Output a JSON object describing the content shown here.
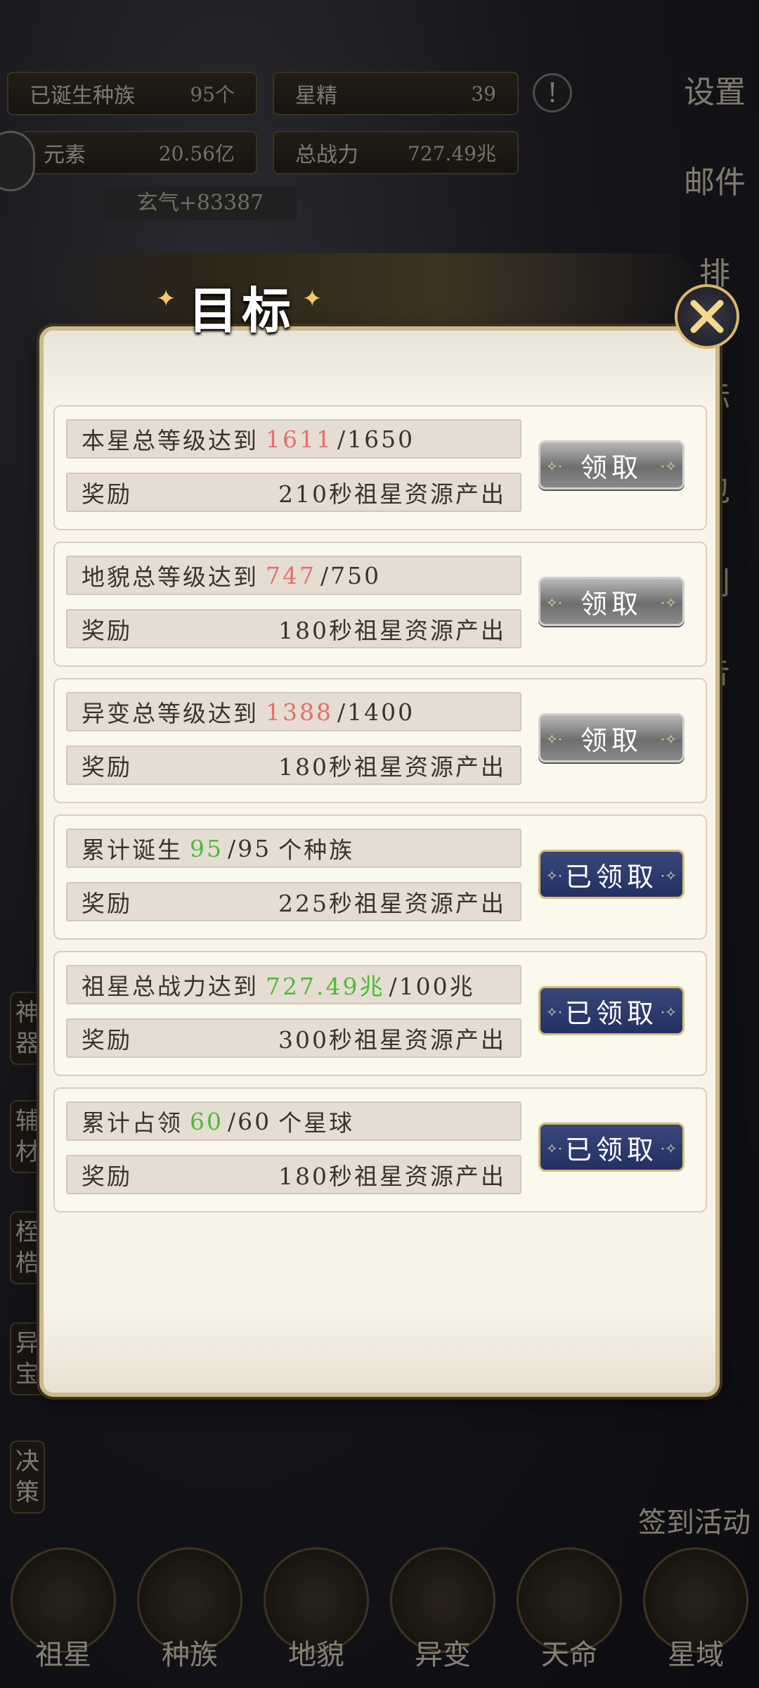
{
  "hud": {
    "born_races_label": "已诞生种族",
    "born_races_value": "95个",
    "star_essence_label": "星精",
    "star_essence_value": "39",
    "element_label": "元素",
    "element_value": "20.56亿",
    "total_power_label": "总战力",
    "total_power_value": "727.49兆",
    "qi_tag": "玄气+83387",
    "alert_icon": "exclamation-icon",
    "right_menu": [
      "设置",
      "邮件",
      "排",
      "标",
      "包",
      "利",
      "告"
    ],
    "left_menu": [
      "神器",
      "辅材",
      "桎梏",
      "异宝",
      "决策"
    ],
    "sign_activity": "签到活动",
    "bottom_nav": [
      "祖星",
      "种族",
      "地貌",
      "异变",
      "天命",
      "星域"
    ]
  },
  "modal": {
    "title": "目标",
    "close_icon": "close-x-icon",
    "reward_label": "奖励",
    "tasks": [
      {
        "prefix": "本星总等级达到",
        "current": "1611",
        "target": "/1650",
        "suffix": "",
        "highlight": "red",
        "reward": "210秒祖星资源产出",
        "button": "领取",
        "state": "claimable"
      },
      {
        "prefix": "地貌总等级达到",
        "current": "747",
        "target": "/750",
        "suffix": "",
        "highlight": "red",
        "reward": "180秒祖星资源产出",
        "button": "领取",
        "state": "claimable"
      },
      {
        "prefix": "异变总等级达到",
        "current": "1388",
        "target": "/1400",
        "suffix": "",
        "highlight": "red",
        "reward": "180秒祖星资源产出",
        "button": "领取",
        "state": "claimable"
      },
      {
        "prefix": "累计诞生",
        "current": "95",
        "target": "/95",
        "suffix": "个种族",
        "highlight": "green",
        "reward": "225秒祖星资源产出",
        "button": "已领取",
        "state": "claimed"
      },
      {
        "prefix": "祖星总战力达到",
        "current": "727.49兆",
        "target": "/100兆",
        "suffix": "",
        "highlight": "green",
        "reward": "300秒祖星资源产出",
        "button": "已领取",
        "state": "claimed"
      },
      {
        "prefix": "累计占领",
        "current": "60",
        "target": "/60",
        "suffix": "个星球",
        "highlight": "green",
        "reward": "180秒祖星资源产出",
        "button": "已领取",
        "state": "claimed"
      }
    ]
  },
  "colors": {
    "highlight_red": "#e56e70",
    "highlight_green": "#4cbb3a",
    "claimed_button": "#2a3668",
    "claim_button": "#7a7a7a"
  }
}
